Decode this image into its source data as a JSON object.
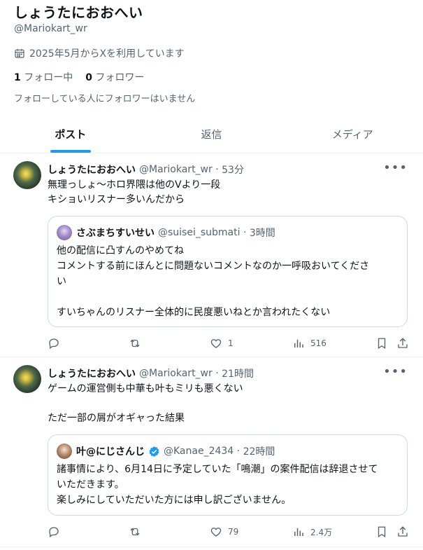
{
  "profile": {
    "name": "しょうたにおおへい",
    "handle": "@Mariokart_wr",
    "joined": "2025年5月からXを利用しています",
    "following_count": "1",
    "following_label": "フォロー中",
    "followers_count": "0",
    "followers_label": "フォロワー",
    "no_followers_note": "フォローしている人にフォロワーはいません"
  },
  "tabs": [
    {
      "label": "ポスト",
      "active": true
    },
    {
      "label": "返信",
      "active": false
    },
    {
      "label": "メディア",
      "active": false
    }
  ],
  "tweets": [
    {
      "display_name": "しょうたにおおへい",
      "handle": "@Mariokart_wr",
      "time": "53分",
      "text": "無理っしょ〜ホロ界隈は他のVより一段\nキショいリスナー多いんだから",
      "quote": {
        "display_name": "さぶまちすいせい",
        "handle": "@suisei_submati",
        "time": "3時間",
        "verified": false,
        "text": "他の配信に凸すんのやめてね\nコメントする前にほんとに問題ないコメントなのか一呼吸おいてくださ\nい\n\nすいちゃんのリスナー全体的に民度悪いねとか言われたくない"
      },
      "replies": "",
      "reposts": "",
      "likes": "1",
      "views": "516"
    },
    {
      "display_name": "しょうたにおおへい",
      "handle": "@Mariokart_wr",
      "time": "21時間",
      "text": "ゲームの運営側も中華も叶もミリも悪くない\n\nただ一部の屑がオギャった結果",
      "quote": {
        "display_name": "叶@にじさんじ",
        "handle": "@Kanae_2434",
        "time": "22時間",
        "verified": true,
        "text": "諸事情により、6月14日に予定していた「鳴潮」の案件配信は辞退させて\nいただきます。\n楽しみにしていただいた方には申し訳ございません。"
      },
      "replies": "",
      "reposts": "",
      "likes": "79",
      "views": "2.4万"
    }
  ],
  "colors": {
    "accent": "#1d9bf0",
    "text_primary": "#0f1419",
    "text_secondary": "#536471",
    "border": "#cfd9de"
  }
}
